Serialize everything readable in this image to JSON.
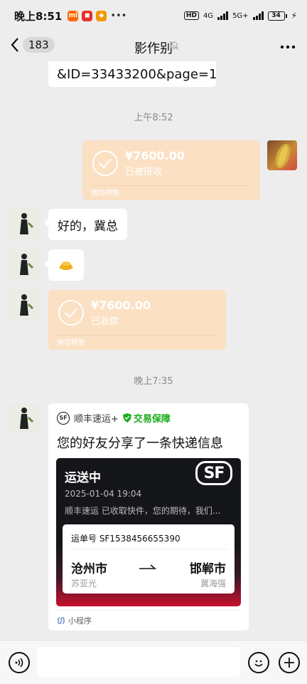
{
  "status_bar": {
    "time": "晚上8:51",
    "hd": "HD",
    "net1": "4G",
    "net2": "5G+",
    "battery": "34"
  },
  "nav": {
    "unread_count": "183",
    "title": "影作别"
  },
  "messages": {
    "url_fragment": "&ID=33433200&page=1",
    "time1": "上午8:52",
    "transfer_out": {
      "amount": "¥7600.00",
      "status": "已被接收",
      "footer": "微信转账"
    },
    "reply_text": "好的，冀总",
    "transfer_in": {
      "amount": "¥7600.00",
      "status": "已收款",
      "footer": "微信转账"
    },
    "time2": "晚上7:35",
    "card": {
      "app_name": "顺丰速运+",
      "guarantee": "交易保障",
      "title": "您的好友分享了一条快递信息",
      "shipping_status": "运送中",
      "date": "2025-01-04 19:04",
      "description": "顺丰速运 已收取快件，您的期待，我们...",
      "waybill": "运单号 SF1538456655390",
      "from_city": "沧州市",
      "from_name": "苏亚光",
      "to_city": "邯郸市",
      "to_name": "冀海强",
      "mini_program": "小程序",
      "logo_text": "SF"
    }
  },
  "colors": {
    "transfer_bg": "#fbe0c3",
    "chat_bg": "#ededed",
    "sf_red": "#c8102e",
    "guarantee_green": "#1aad19"
  }
}
